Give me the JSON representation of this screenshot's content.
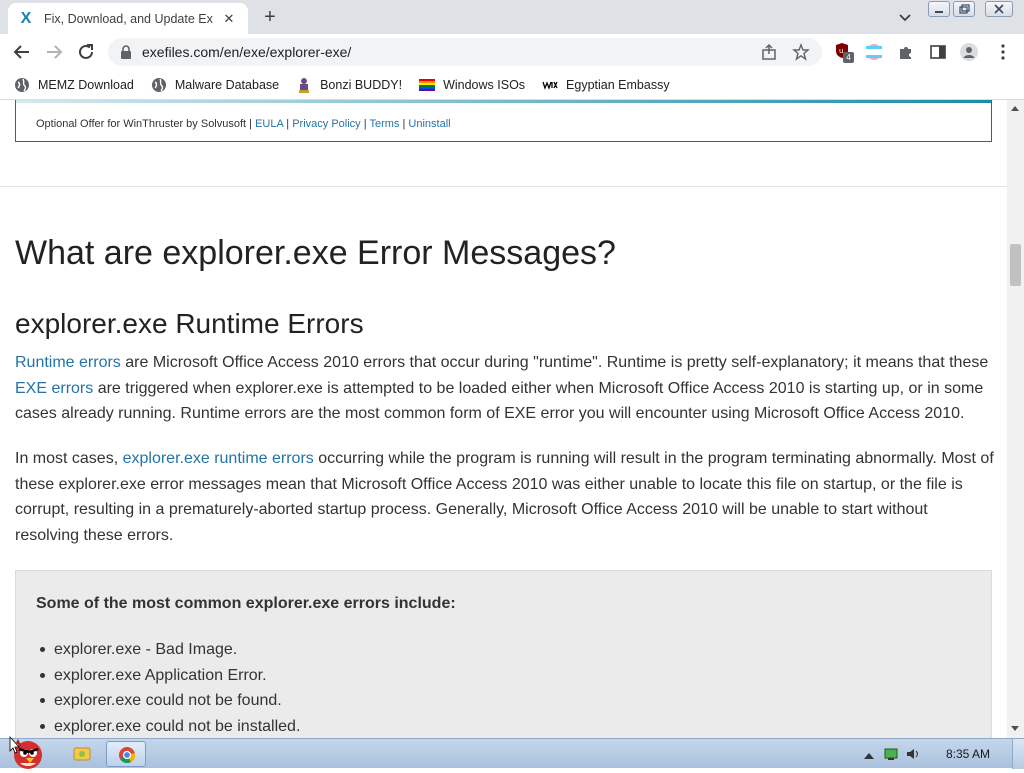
{
  "browser": {
    "tab": {
      "title": "Fix, Download, and Update Ex",
      "favicon": "X"
    },
    "url": "exefiles.com/en/exe/explorer-exe/",
    "extension_badge": "4"
  },
  "bookmarks": [
    {
      "label": "MEMZ Download",
      "icon": "globe-icon"
    },
    {
      "label": "Malware Database",
      "icon": "globe-icon"
    },
    {
      "label": "Bonzi BUDDY!",
      "icon": "bonzi-icon"
    },
    {
      "label": "Windows ISOs",
      "icon": "rainbow-flag-icon"
    },
    {
      "label": "Egyptian Embassy",
      "icon": "wix-icon"
    }
  ],
  "offer": {
    "text": "Optional Offer for WinThruster by Solvusoft | ",
    "links": [
      "EULA",
      "Privacy Policy",
      "Terms",
      "Uninstall"
    ]
  },
  "article": {
    "h1": "What are explorer.exe Error Messages?",
    "h2": "explorer.exe Runtime Errors",
    "para1": {
      "link1": "Runtime errors",
      "text1": " are Microsoft Office Access 2010 errors that occur during \"runtime\". Runtime is pretty self-explanatory; it means that these ",
      "link2": "EXE errors",
      "text2": " are triggered when explorer.exe is attempted to be loaded either when Microsoft Office Access 2010 is starting up, or in some cases already running. Runtime errors are the most common form of EXE error you will encounter using Microsoft Office Access 2010."
    },
    "para2": {
      "text1": "In most cases, ",
      "link1": "explorer.exe runtime errors",
      "text2": " occurring while the program is running will result in the program terminating abnormally. Most of these explorer.exe error messages mean that Microsoft Office Access 2010 was either unable to locate this file on startup, or the file is corrupt, resulting in a prematurely-aborted startup process. Generally, Microsoft Office Access 2010 will be unable to start without resolving these errors."
    },
    "errors_box": {
      "heading": "Some of the most common explorer.exe errors include:",
      "items": [
        "explorer.exe - Bad Image.",
        "explorer.exe Application Error.",
        "explorer.exe could not be found.",
        "explorer.exe could not be installed."
      ]
    }
  },
  "taskbar": {
    "time": "8:35 AM"
  },
  "colors": {
    "link": "#2274a5",
    "accent": "#1b8ca8",
    "tab_strip": "#dee1e6"
  }
}
